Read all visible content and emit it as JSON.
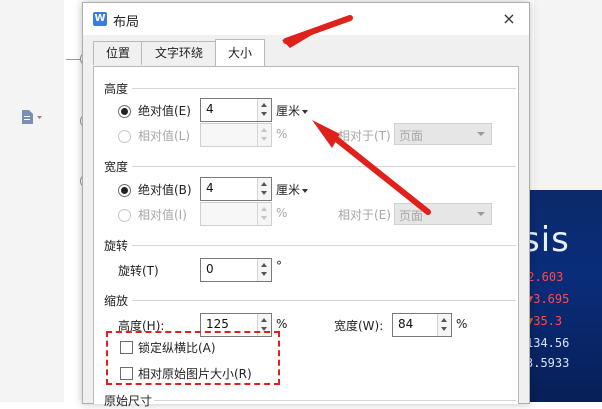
{
  "dialog": {
    "title": "布局",
    "app_icon": "W",
    "close_glyph": "×"
  },
  "tabs": [
    {
      "label": "位置"
    },
    {
      "label": "文字环绕"
    },
    {
      "label": "大小"
    }
  ],
  "height": {
    "section": "高度",
    "absolute_label": "绝对值(E)",
    "absolute_value": "4",
    "absolute_unit": "厘米",
    "relative_label": "相对值(L)",
    "relative_unit": "%",
    "relative_to_label": "相对于(T)",
    "relative_to_value": "页面"
  },
  "width": {
    "section": "宽度",
    "absolute_label": "绝对值(B)",
    "absolute_value": "4",
    "absolute_unit": "厘米",
    "relative_label": "相对值(I)",
    "relative_unit": "%",
    "relative_to_label": "相对于(E)",
    "relative_to_value": "页面"
  },
  "rotation": {
    "section": "旋转",
    "label": "旋转(T)",
    "value": "0",
    "unit": "°"
  },
  "scale": {
    "section": "缩放",
    "height_label": "高度(H):",
    "height_value": "125",
    "height_unit": "%",
    "width_label": "宽度(W):",
    "width_value": "84",
    "width_unit": "%",
    "lock_aspect_label": "锁定纵横比(A)",
    "relative_original_label": "相对原始图片大小(R)"
  },
  "original_size": {
    "section": "原始尺寸"
  },
  "background_image": {
    "text": "sis",
    "numbers": [
      "+2.603",
      "▼3.695",
      "▼35.3",
      "134.56",
      "3.5933"
    ]
  },
  "colors": {
    "annotation_red": "#e0201a",
    "accent_blue": "#3a7de0"
  }
}
